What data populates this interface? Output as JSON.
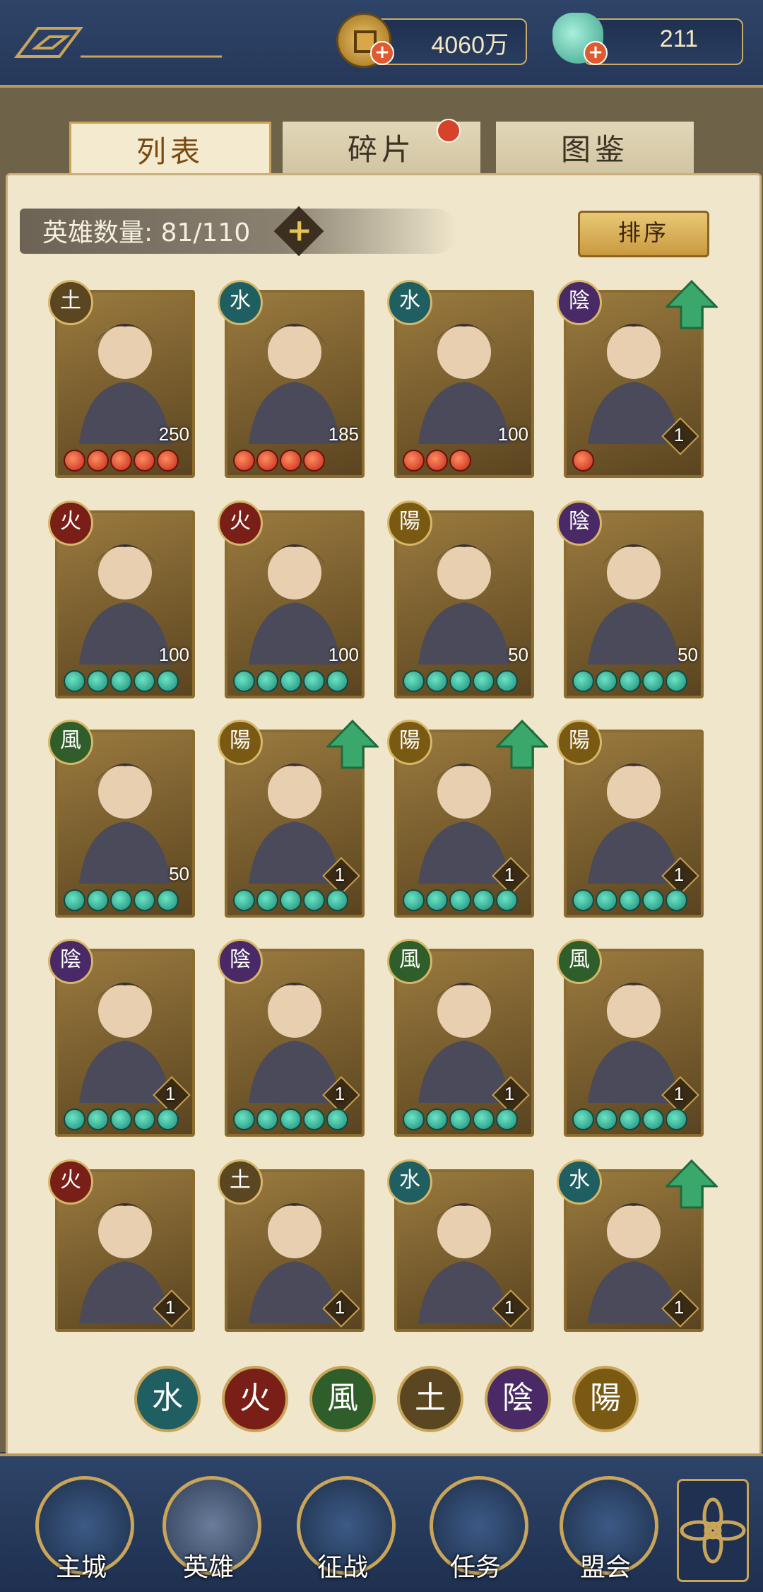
{
  "resources": {
    "coins": "4060万",
    "jade": "211"
  },
  "tabs": [
    {
      "label": "列表",
      "active": true
    },
    {
      "label": "碎片",
      "active": false,
      "has_dot": true
    },
    {
      "label": "图鉴",
      "active": false
    }
  ],
  "hero_count": {
    "label": "英雄数量: ",
    "value": "81/110"
  },
  "sort_label": "排序",
  "element_colors": {
    "水": "#1f5f62",
    "火": "#7a1e18",
    "风": "#2f5e2a",
    "土": "#5a4620",
    "阴": "#4a2a66",
    "阳": "#7a5a12"
  },
  "heroes": [
    {
      "element": "土",
      "level": "250",
      "stars": 5,
      "star_color": "red",
      "upgrade": false
    },
    {
      "element": "水",
      "level": "185",
      "stars": 4,
      "star_color": "red",
      "upgrade": false
    },
    {
      "element": "水",
      "level": "100",
      "stars": 3,
      "star_color": "red",
      "upgrade": false
    },
    {
      "element": "陰",
      "level": "1",
      "stars": 1,
      "star_color": "red",
      "upgrade": true
    },
    {
      "element": "火",
      "level": "100",
      "stars": 5,
      "star_color": "green",
      "upgrade": false
    },
    {
      "element": "火",
      "level": "100",
      "stars": 5,
      "star_color": "green",
      "upgrade": false
    },
    {
      "element": "陽",
      "level": "50",
      "stars": 5,
      "star_color": "green",
      "upgrade": false
    },
    {
      "element": "陰",
      "level": "50",
      "stars": 5,
      "star_color": "green",
      "upgrade": false
    },
    {
      "element": "風",
      "level": "50",
      "stars": 5,
      "star_color": "green",
      "upgrade": false
    },
    {
      "element": "陽",
      "level": "1",
      "stars": 5,
      "star_color": "green",
      "upgrade": true
    },
    {
      "element": "陽",
      "level": "1",
      "stars": 5,
      "star_color": "green",
      "upgrade": true
    },
    {
      "element": "陽",
      "level": "1",
      "stars": 5,
      "star_color": "green",
      "upgrade": false
    },
    {
      "element": "陰",
      "level": "1",
      "stars": 5,
      "star_color": "green",
      "upgrade": false
    },
    {
      "element": "陰",
      "level": "1",
      "stars": 5,
      "star_color": "green",
      "upgrade": false
    },
    {
      "element": "風",
      "level": "1",
      "stars": 5,
      "star_color": "green",
      "upgrade": false
    },
    {
      "element": "風",
      "level": "1",
      "stars": 5,
      "star_color": "green",
      "upgrade": false
    },
    {
      "element": "火",
      "level": "1",
      "stars": 5,
      "star_color": "green",
      "upgrade": false
    },
    {
      "element": "土",
      "level": "1",
      "stars": 5,
      "star_color": "green",
      "upgrade": false
    },
    {
      "element": "水",
      "level": "1",
      "stars": 5,
      "star_color": "green",
      "upgrade": false
    },
    {
      "element": "水",
      "level": "1",
      "stars": 5,
      "star_color": "green",
      "upgrade": true
    }
  ],
  "element_filters": [
    "水",
    "火",
    "風",
    "土",
    "陰",
    "陽"
  ],
  "nav": [
    {
      "label": "主城",
      "icon": "castle-icon"
    },
    {
      "label": "英雄",
      "icon": "hero-icon"
    },
    {
      "label": "征战",
      "icon": "battle-icon"
    },
    {
      "label": "任务",
      "icon": "scroll-icon"
    },
    {
      "label": "盟会",
      "icon": "pavilion-icon"
    }
  ]
}
